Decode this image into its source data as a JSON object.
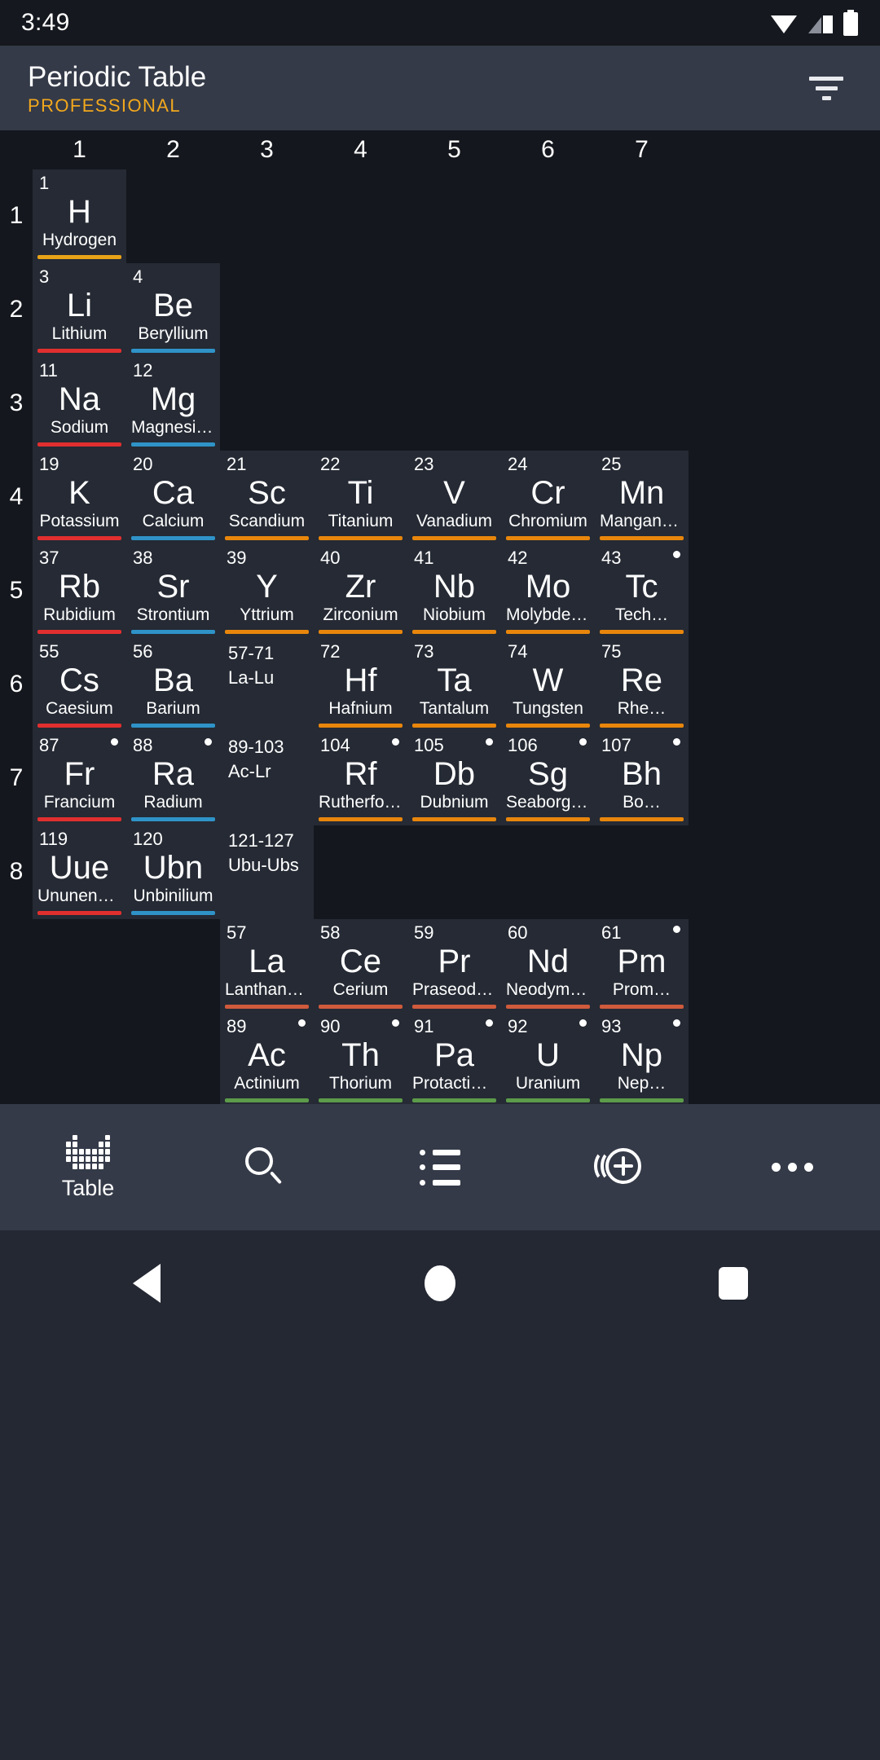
{
  "status_bar": {
    "time": "3:49",
    "icons": [
      "wifi-icon",
      "signal-icon",
      "battery-icon"
    ]
  },
  "app_bar": {
    "title": "Periodic Table",
    "subtitle": "PROFESSIONAL",
    "subtitle_color": "#f2a81d",
    "action_icon": "filter-sort-icon"
  },
  "table": {
    "column_headers": [
      "1",
      "2",
      "3",
      "4",
      "5",
      "6",
      "7"
    ],
    "row_headers": [
      "1",
      "2",
      "3",
      "4",
      "5",
      "6",
      "7",
      "8"
    ],
    "category_colors": {
      "reactive-nonmetal": "#e8a317",
      "alkali-metal": "#e12f2f",
      "alkaline-earth-metal": "#2f93c8",
      "transition-metal": "#e8860c",
      "lanthanide": "#cf5a3c",
      "actinide": "#5c9b4a"
    },
    "cells": [
      {
        "n": "1",
        "sym": "H",
        "name": "Hydrogen",
        "cat": "reactive-nonmetal",
        "col": 1,
        "row": 1,
        "rad": false
      },
      {
        "n": "3",
        "sym": "Li",
        "name": "Lithium",
        "cat": "alkali-metal",
        "col": 1,
        "row": 2,
        "rad": false
      },
      {
        "n": "4",
        "sym": "Be",
        "name": "Beryllium",
        "cat": "alkaline-earth-metal",
        "col": 2,
        "row": 2,
        "rad": false
      },
      {
        "n": "11",
        "sym": "Na",
        "name": "Sodium",
        "cat": "alkali-metal",
        "col": 1,
        "row": 3,
        "rad": false
      },
      {
        "n": "12",
        "sym": "Mg",
        "name": "Magnesium",
        "cat": "alkaline-earth-metal",
        "col": 2,
        "row": 3,
        "rad": false
      },
      {
        "n": "19",
        "sym": "K",
        "name": "Potassium",
        "cat": "alkali-metal",
        "col": 1,
        "row": 4,
        "rad": false
      },
      {
        "n": "20",
        "sym": "Ca",
        "name": "Calcium",
        "cat": "alkaline-earth-metal",
        "col": 2,
        "row": 4,
        "rad": false
      },
      {
        "n": "21",
        "sym": "Sc",
        "name": "Scandium",
        "cat": "transition-metal",
        "col": 3,
        "row": 4,
        "rad": false
      },
      {
        "n": "22",
        "sym": "Ti",
        "name": "Titanium",
        "cat": "transition-metal",
        "col": 4,
        "row": 4,
        "rad": false
      },
      {
        "n": "23",
        "sym": "V",
        "name": "Vanadium",
        "cat": "transition-metal",
        "col": 5,
        "row": 4,
        "rad": false
      },
      {
        "n": "24",
        "sym": "Cr",
        "name": "Chromium",
        "cat": "transition-metal",
        "col": 6,
        "row": 4,
        "rad": false
      },
      {
        "n": "25",
        "sym": "Mn",
        "name": "Manganese",
        "cat": "transition-metal",
        "col": 7,
        "row": 4,
        "rad": false
      },
      {
        "n": "37",
        "sym": "Rb",
        "name": "Rubidium",
        "cat": "alkali-metal",
        "col": 1,
        "row": 5,
        "rad": false
      },
      {
        "n": "38",
        "sym": "Sr",
        "name": "Strontium",
        "cat": "alkaline-earth-metal",
        "col": 2,
        "row": 5,
        "rad": false
      },
      {
        "n": "39",
        "sym": "Y",
        "name": "Yttrium",
        "cat": "transition-metal",
        "col": 3,
        "row": 5,
        "rad": false
      },
      {
        "n": "40",
        "sym": "Zr",
        "name": "Zirconium",
        "cat": "transition-metal",
        "col": 4,
        "row": 5,
        "rad": false
      },
      {
        "n": "41",
        "sym": "Nb",
        "name": "Niobium",
        "cat": "transition-metal",
        "col": 5,
        "row": 5,
        "rad": false
      },
      {
        "n": "42",
        "sym": "Mo",
        "name": "Molybden…",
        "cat": "transition-metal",
        "col": 6,
        "row": 5,
        "rad": false
      },
      {
        "n": "43",
        "sym": "Tc",
        "name": "Tech…",
        "cat": "transition-metal",
        "col": 7,
        "row": 5,
        "rad": true
      },
      {
        "n": "55",
        "sym": "Cs",
        "name": "Caesium",
        "cat": "alkali-metal",
        "col": 1,
        "row": 6,
        "rad": false
      },
      {
        "n": "56",
        "sym": "Ba",
        "name": "Barium",
        "cat": "alkaline-earth-metal",
        "col": 2,
        "row": 6,
        "rad": false
      },
      {
        "n": "57-71",
        "sym": "",
        "name": "",
        "sub": "La-Lu",
        "cat": "range",
        "col": 3,
        "row": 6,
        "rad": false
      },
      {
        "n": "72",
        "sym": "Hf",
        "name": "Hafnium",
        "cat": "transition-metal",
        "col": 4,
        "row": 6,
        "rad": false
      },
      {
        "n": "73",
        "sym": "Ta",
        "name": "Tantalum",
        "cat": "transition-metal",
        "col": 5,
        "row": 6,
        "rad": false
      },
      {
        "n": "74",
        "sym": "W",
        "name": "Tungsten",
        "cat": "transition-metal",
        "col": 6,
        "row": 6,
        "rad": false
      },
      {
        "n": "75",
        "sym": "Re",
        "name": "Rhe…",
        "cat": "transition-metal",
        "col": 7,
        "row": 6,
        "rad": false
      },
      {
        "n": "87",
        "sym": "Fr",
        "name": "Francium",
        "cat": "alkali-metal",
        "col": 1,
        "row": 7,
        "rad": true
      },
      {
        "n": "88",
        "sym": "Ra",
        "name": "Radium",
        "cat": "alkaline-earth-metal",
        "col": 2,
        "row": 7,
        "rad": true
      },
      {
        "n": "89-103",
        "sym": "",
        "name": "",
        "sub": "Ac-Lr",
        "cat": "range",
        "col": 3,
        "row": 7,
        "rad": false
      },
      {
        "n": "104",
        "sym": "Rf",
        "name": "Rutherfor…",
        "cat": "transition-metal",
        "col": 4,
        "row": 7,
        "rad": true
      },
      {
        "n": "105",
        "sym": "Db",
        "name": "Dubnium",
        "cat": "transition-metal",
        "col": 5,
        "row": 7,
        "rad": true
      },
      {
        "n": "106",
        "sym": "Sg",
        "name": "Seaborgium",
        "cat": "transition-metal",
        "col": 6,
        "row": 7,
        "rad": true
      },
      {
        "n": "107",
        "sym": "Bh",
        "name": "Bo…",
        "cat": "transition-metal",
        "col": 7,
        "row": 7,
        "rad": true
      },
      {
        "n": "119",
        "sym": "Uue",
        "name": "Ununenni…",
        "cat": "alkali-metal",
        "col": 1,
        "row": 8,
        "rad": false
      },
      {
        "n": "120",
        "sym": "Ubn",
        "name": "Unbinilium",
        "cat": "alkaline-earth-metal",
        "col": 2,
        "row": 8,
        "rad": false
      },
      {
        "n": "121-127",
        "sym": "",
        "name": "",
        "sub": "Ubu-Ubs",
        "cat": "range",
        "col": 3,
        "row": 8,
        "rad": false
      },
      {
        "n": "57",
        "sym": "La",
        "name": "Lanthanum",
        "cat": "lanthanide",
        "col": 3,
        "row": 9,
        "rad": false
      },
      {
        "n": "58",
        "sym": "Ce",
        "name": "Cerium",
        "cat": "lanthanide",
        "col": 4,
        "row": 9,
        "rad": false
      },
      {
        "n": "59",
        "sym": "Pr",
        "name": "Praseody…",
        "cat": "lanthanide",
        "col": 5,
        "row": 9,
        "rad": false
      },
      {
        "n": "60",
        "sym": "Nd",
        "name": "Neodymiu…",
        "cat": "lanthanide",
        "col": 6,
        "row": 9,
        "rad": false
      },
      {
        "n": "61",
        "sym": "Pm",
        "name": "Prom…",
        "cat": "lanthanide",
        "col": 7,
        "row": 9,
        "rad": true
      },
      {
        "n": "89",
        "sym": "Ac",
        "name": "Actinium",
        "cat": "actinide",
        "col": 3,
        "row": 10,
        "rad": true
      },
      {
        "n": "90",
        "sym": "Th",
        "name": "Thorium",
        "cat": "actinide",
        "col": 4,
        "row": 10,
        "rad": true
      },
      {
        "n": "91",
        "sym": "Pa",
        "name": "Protactini…",
        "cat": "actinide",
        "col": 5,
        "row": 10,
        "rad": true
      },
      {
        "n": "92",
        "sym": "U",
        "name": "Uranium",
        "cat": "actinide",
        "col": 6,
        "row": 10,
        "rad": true
      },
      {
        "n": "93",
        "sym": "Np",
        "name": "Nep…",
        "cat": "actinide",
        "col": 7,
        "row": 10,
        "rad": true
      }
    ]
  },
  "bottom_nav": {
    "items": [
      {
        "icon": "table-grid-icon",
        "label": "Table",
        "selected": true
      },
      {
        "icon": "search-icon",
        "label": "",
        "selected": false
      },
      {
        "icon": "list-icon",
        "label": "",
        "selected": false
      },
      {
        "icon": "isotope-add-icon",
        "label": "",
        "selected": false
      },
      {
        "icon": "more-overflow-icon",
        "label": "",
        "selected": false
      }
    ]
  },
  "android_nav": {
    "back": "back-button",
    "home": "home-button",
    "recents": "recents-button"
  }
}
